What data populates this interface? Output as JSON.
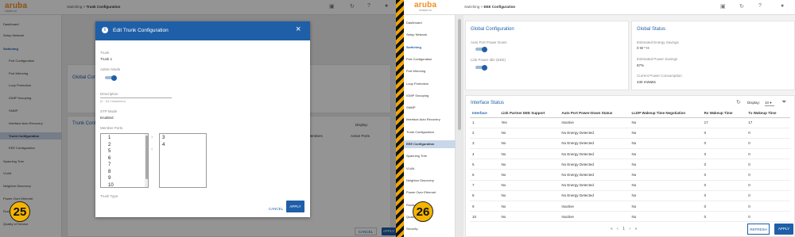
{
  "left": {
    "logo": "aruba",
    "logo_sub": "instant on",
    "breadcrumb": {
      "parent": "Switching",
      "sep": ">",
      "current": "Trunk Configuration"
    },
    "sidebar": [
      {
        "label": "Dashboard",
        "kind": "item"
      },
      {
        "label": "Setup Network",
        "kind": "item"
      },
      {
        "label": "Switching",
        "kind": "section"
      },
      {
        "label": "Port Configuration",
        "kind": "sub"
      },
      {
        "label": "Port Mirroring",
        "kind": "sub"
      },
      {
        "label": "Loop Protection",
        "kind": "sub"
      },
      {
        "label": "IGMP Snooping",
        "kind": "sub"
      },
      {
        "label": "SNMP",
        "kind": "sub"
      },
      {
        "label": "Interface Auto Recovery",
        "kind": "sub"
      },
      {
        "label": "Trunk Configuration",
        "kind": "active"
      },
      {
        "label": "EEE Configuration",
        "kind": "sub"
      },
      {
        "label": "Spanning Tree",
        "kind": "item"
      },
      {
        "label": "VLAN",
        "kind": "item"
      },
      {
        "label": "Neighbor Discovery",
        "kind": "item"
      },
      {
        "label": "Power Over Ethernet",
        "kind": "item"
      },
      {
        "label": "Routing",
        "kind": "item"
      },
      {
        "label": "Quality of Service",
        "kind": "item"
      }
    ],
    "bg": {
      "global_config": "Global Configuration",
      "trunk_config": "Trunk Configuration",
      "display_label": "Display:",
      "members_col": "Members",
      "active_ports_col": "Active Ports",
      "cancel": "CANCEL",
      "apply": "APPLY"
    },
    "modal": {
      "title": "Edit Trunk Configuration",
      "trunk_label": "Trunk",
      "trunk_value": "Trunk 1",
      "admin_mode_label": "Admin Mode",
      "description_label": "Description",
      "description_hint": "(0 - 64 Characters)",
      "stp_mode_label": "STP Mode",
      "stp_mode_value": "Enabled",
      "member_ports_label": "Member Ports",
      "available_ports": [
        "1",
        "2",
        "5",
        "6",
        "7",
        "8",
        "9",
        "10"
      ],
      "selected_ports": [
        "3",
        "4"
      ],
      "trunk_type_label": "Trunk Type",
      "cancel": "CANCEL",
      "apply": "APPLY"
    },
    "step_badge": "25"
  },
  "right": {
    "logo": "aruba",
    "logo_sub": "instant on",
    "breadcrumb": {
      "parent": "Switching",
      "sep": ">",
      "current": "EEE Configuration"
    },
    "sidebar": [
      {
        "label": "Dashboard",
        "kind": "item"
      },
      {
        "label": "Setup Network",
        "kind": "item"
      },
      {
        "label": "Switching",
        "kind": "section"
      },
      {
        "label": "Port Configuration",
        "kind": "sub"
      },
      {
        "label": "Port Mirroring",
        "kind": "sub"
      },
      {
        "label": "Loop Protection",
        "kind": "sub"
      },
      {
        "label": "IGMP Snooping",
        "kind": "sub"
      },
      {
        "label": "SNMP",
        "kind": "sub"
      },
      {
        "label": "Interface Auto Recovery",
        "kind": "sub"
      },
      {
        "label": "Trunk Configuration",
        "kind": "sub"
      },
      {
        "label": "EEE Configuration",
        "kind": "active"
      },
      {
        "label": "Spanning Tree",
        "kind": "item"
      },
      {
        "label": "VLAN",
        "kind": "item"
      },
      {
        "label": "Neighbor Discovery",
        "kind": "item"
      },
      {
        "label": "Power Over Ethernet",
        "kind": "item"
      },
      {
        "label": "Routing",
        "kind": "item"
      },
      {
        "label": "Quality of Service",
        "kind": "item"
      },
      {
        "label": "Security",
        "kind": "item"
      }
    ],
    "global_config": {
      "title": "Global Configuration",
      "auto_port_power_down": "Auto Port Power Down",
      "link_power_idle": "Link Power Idle (EEE)"
    },
    "global_status": {
      "title": "Global Status",
      "est_energy_label": "Estimated Energy Savings",
      "est_energy_value": "0 W * H",
      "est_power_label": "Estimated Power Savings",
      "est_power_value": "87%",
      "current_power_label": "Current Power Consumption",
      "current_power_value": "430 mWatts"
    },
    "interface_status": {
      "title": "Interface Status",
      "display_label": "Display:",
      "display_value": "10",
      "columns": [
        "Interface",
        "Link Partner EEE Support",
        "Auto Port Power-Down Status",
        "LLDP Wakeup Time Negotiation",
        "Rx Wakeup Time",
        "Tx Wakeup Time"
      ],
      "rows": [
        [
          "1",
          "Yes",
          "Inactive",
          "No",
          "17",
          "17"
        ],
        [
          "2",
          "No",
          "No Energy Detected",
          "No",
          "0",
          "0"
        ],
        [
          "3",
          "No",
          "No Energy Detected",
          "No",
          "0",
          "0"
        ],
        [
          "4",
          "No",
          "No Energy Detected",
          "No",
          "0",
          "0"
        ],
        [
          "5",
          "No",
          "No Energy Detected",
          "No",
          "0",
          "0"
        ],
        [
          "6",
          "No",
          "No Energy Detected",
          "No",
          "0",
          "0"
        ],
        [
          "7",
          "No",
          "No Energy Detected",
          "No",
          "0",
          "0"
        ],
        [
          "8",
          "No",
          "No Energy Detected",
          "No",
          "0",
          "0"
        ],
        [
          "9",
          "No",
          "Inactive",
          "No",
          "0",
          "0"
        ],
        [
          "10",
          "No",
          "Inactive",
          "No",
          "0",
          "0"
        ]
      ],
      "pagination": {
        "first": "«",
        "prev": "‹",
        "page": "1",
        "next": "›",
        "last": "»"
      }
    },
    "refresh": "REFRESH",
    "apply": "APPLY",
    "step_badge": "26"
  },
  "colors": {
    "accent": "#1f5fa8",
    "brand": "#f68b1f",
    "badge": "#f4b400"
  }
}
